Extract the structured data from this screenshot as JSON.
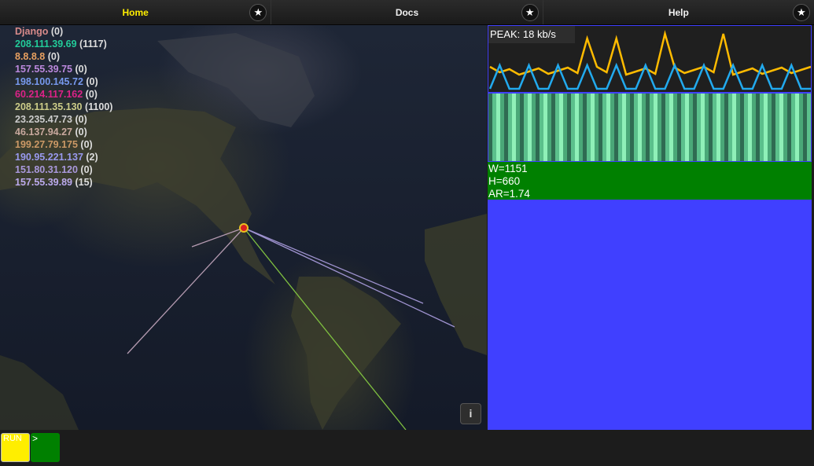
{
  "tabs": [
    {
      "label": "Home",
      "active": true,
      "star_icon": "star-icon"
    },
    {
      "label": "Docs",
      "active": false,
      "star_icon": "star-icon"
    },
    {
      "label": "Help",
      "active": false,
      "star_icon": "star-icon"
    }
  ],
  "map": {
    "legend": [
      {
        "ip": "Django",
        "count": "(0)",
        "color": "#d88a8a"
      },
      {
        "ip": "208.111.39.69",
        "count": "(1117)",
        "color": "#22cc99"
      },
      {
        "ip": "8.8.8.8",
        "count": "(0)",
        "color": "#e8a060"
      },
      {
        "ip": "157.55.39.75",
        "count": "(0)",
        "color": "#bb88dd"
      },
      {
        "ip": "198.100.145.72",
        "count": "(0)",
        "color": "#7799ee"
      },
      {
        "ip": "60.214.117.162",
        "count": "(0)",
        "color": "#dd2288"
      },
      {
        "ip": "208.111.35.130",
        "count": "(1100)",
        "color": "#cccc88"
      },
      {
        "ip": "23.235.47.73",
        "count": "(0)",
        "color": "#cccccc"
      },
      {
        "ip": "46.137.94.27",
        "count": "(0)",
        "color": "#c9a99e"
      },
      {
        "ip": "199.27.79.175",
        "count": "(0)",
        "color": "#cc9966"
      },
      {
        "ip": "190.95.221.137",
        "count": "(2)",
        "color": "#9999ee"
      },
      {
        "ip": "151.80.31.120",
        "count": "(0)",
        "color": "#aa99dd"
      },
      {
        "ip": "157.55.39.89",
        "count": "(15)",
        "color": "#bbaaee"
      }
    ],
    "info_label": "i"
  },
  "traffic": {
    "peak_label": "PEAK: 18 kb/s",
    "colors": {
      "upload": "#ffbb00",
      "download": "#22aaee"
    }
  },
  "stats": {
    "w": "W=1151",
    "h": "H=660",
    "ar": "AR=1.74"
  },
  "bottom": {
    "run_label": "RUN",
    "prompt_label": ">"
  }
}
